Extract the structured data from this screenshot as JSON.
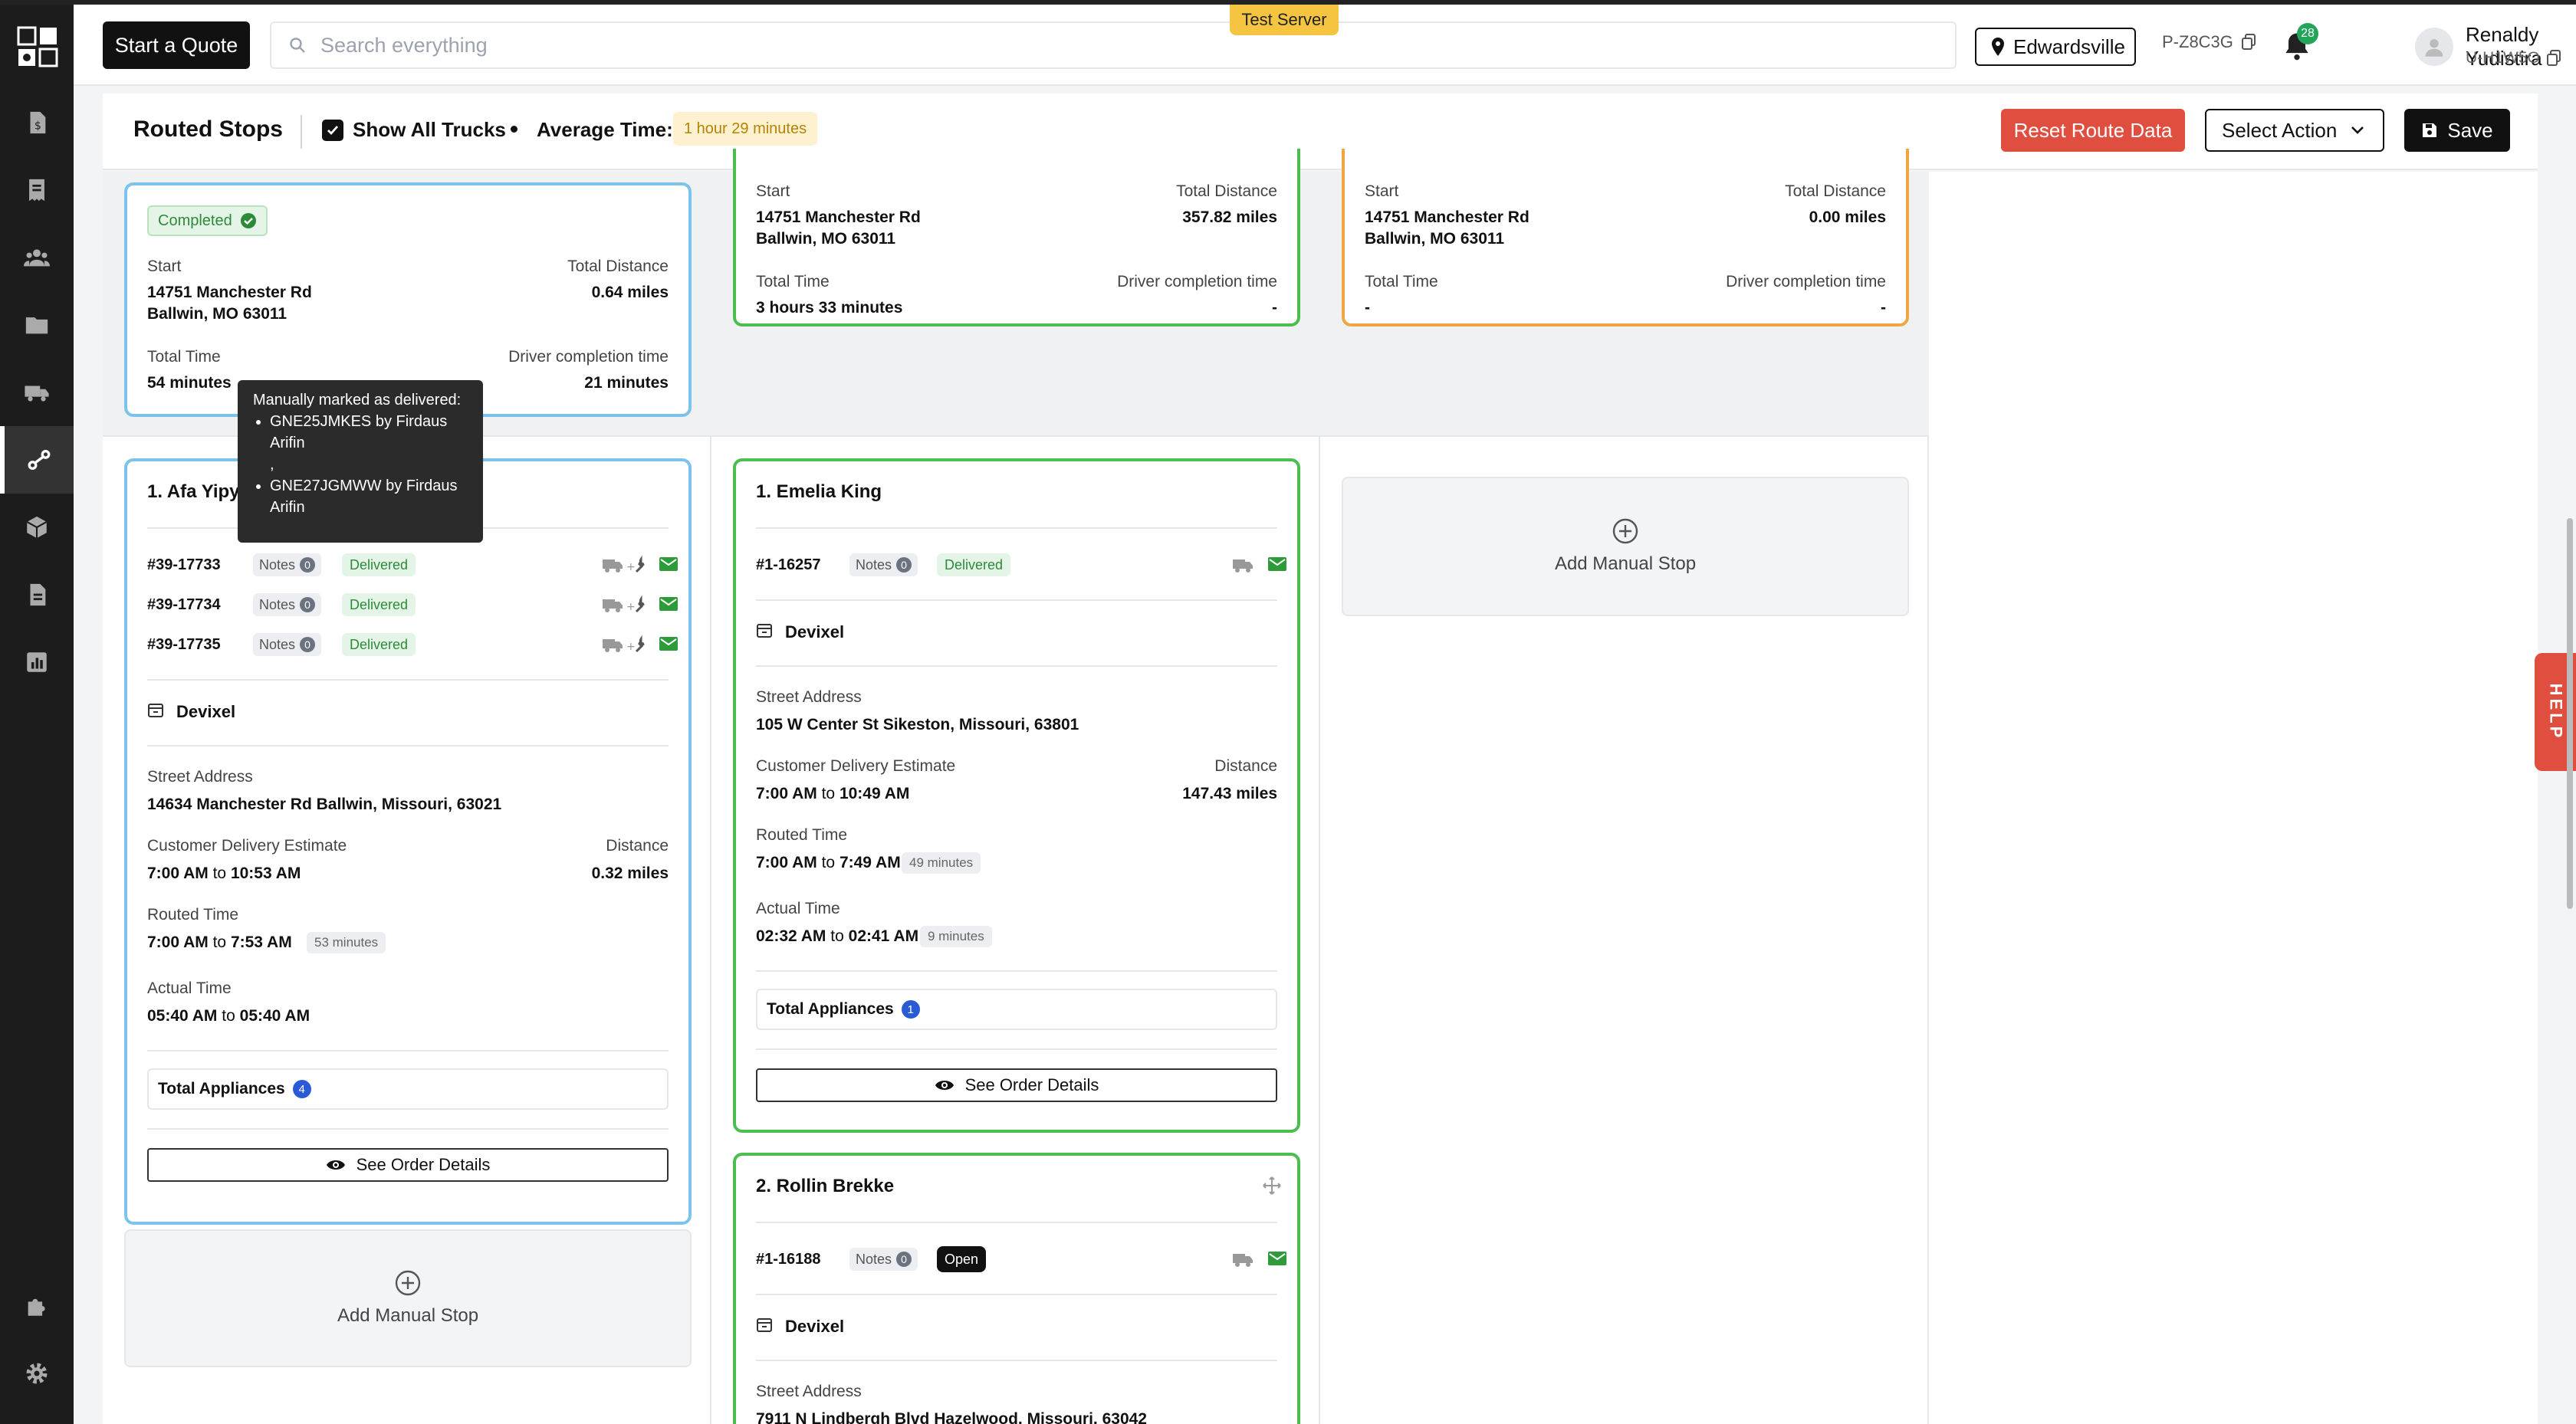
{
  "header": {
    "start_quote": "Start a Quote",
    "search_placeholder": "Search everything",
    "test_server": "Test Server",
    "location": "Edwardsville",
    "project_id": "P-Z8C3G",
    "notif_count": "28",
    "user_name": "Renaldy Yudistira",
    "user_id": "U-H1W5O"
  },
  "toolbar": {
    "title": "Routed Stops",
    "show_all_trucks": "Show All Trucks",
    "avg_label": "Average Time:",
    "avg_value": "1 hour 29 minutes",
    "reset": "Reset Route Data",
    "select_action": "Select Action",
    "save": "Save"
  },
  "summaries": [
    {
      "status": "Completed",
      "start_label": "Start",
      "start_addr1": "14751 Manchester Rd",
      "start_addr2": "Ballwin, MO 63011",
      "dist_label": "Total Distance",
      "dist": "0.64 miles",
      "time_label": "Total Time",
      "time": "54 minutes",
      "dct_label": "Driver completion time",
      "dct": "21 minutes"
    },
    {
      "start_label": "Start",
      "start_addr1": "14751 Manchester Rd",
      "start_addr2": "Ballwin, MO 63011",
      "dist_label": "Total Distance",
      "dist": "357.82 miles",
      "time_label": "Total Time",
      "time": "3 hours 33 minutes",
      "dct_label": "Driver completion time",
      "dct": "-"
    },
    {
      "start_label": "Start",
      "start_addr1": "14751 Manchester Rd",
      "start_addr2": "Ballwin, MO 63011",
      "dist_label": "Total Distance",
      "dist": "0.00 miles",
      "time_label": "Total Time",
      "time": "-",
      "dct_label": "Driver completion time",
      "dct": "-"
    }
  ],
  "stops": {
    "afa": {
      "title": "1. Afa Yipy",
      "orders": [
        {
          "no": "#39-17733",
          "notes": "Notes",
          "count": "0",
          "status": "Delivered"
        },
        {
          "no": "#39-17734",
          "notes": "Notes",
          "count": "0",
          "status": "Delivered"
        },
        {
          "no": "#39-17735",
          "notes": "Notes",
          "count": "0",
          "status": "Delivered"
        }
      ],
      "store": "Devixel",
      "addr_label": "Street Address",
      "addr": "14634 Manchester Rd Ballwin, Missouri, 63021",
      "est_label": "Customer Delivery Estimate",
      "est_from": "7:00 AM",
      "est_to": "10:53 AM",
      "to": "to",
      "dist_label": "Distance",
      "dist": "0.32 miles",
      "routed_label": "Routed Time",
      "routed_from": "7:00 AM",
      "routed_to": "7:53 AM",
      "routed_dur": "53 minutes",
      "actual_label": "Actual Time",
      "actual_from": "05:40 AM",
      "actual_to": "05:40 AM",
      "appl_label": "Total Appliances",
      "appl_count": "4",
      "see": "See Order Details"
    },
    "emelia": {
      "title": "1. Emelia King",
      "order_no": "#1-16257",
      "notes": "Notes",
      "count": "0",
      "status": "Delivered",
      "store": "Devixel",
      "addr_label": "Street Address",
      "addr": "105 W Center St Sikeston, Missouri, 63801",
      "est_label": "Customer Delivery Estimate",
      "est_from": "7:00 AM",
      "est_to": "10:49 AM",
      "to": "to",
      "dist_label": "Distance",
      "dist": "147.43 miles",
      "routed_label": "Routed Time",
      "routed_from": "7:00 AM",
      "routed_to": "7:49 AM",
      "routed_dur": "49 minutes",
      "actual_label": "Actual Time",
      "actual_from": "02:32 AM",
      "actual_to": "02:41 AM",
      "actual_dur": "9 minutes",
      "appl_label": "Total Appliances",
      "appl_count": "1",
      "see": "See Order Details"
    },
    "rollin": {
      "title": "2. Rollin Brekke",
      "order_no": "#1-16188",
      "notes": "Notes",
      "count": "0",
      "status": "Open",
      "store": "Devixel",
      "addr_label": "Street Address",
      "addr": "7911 N Lindbergh Blvd Hazelwood, Missouri, 63042"
    }
  },
  "manual_stop": "Add Manual Stop",
  "tooltip": {
    "heading": "Manually marked as delivered:",
    "items": [
      "GNE25JMKES by Firdaus Arifin",
      "GNE27JGMWW by Firdaus Arifin"
    ],
    "sep": ","
  },
  "help": "HELP"
}
